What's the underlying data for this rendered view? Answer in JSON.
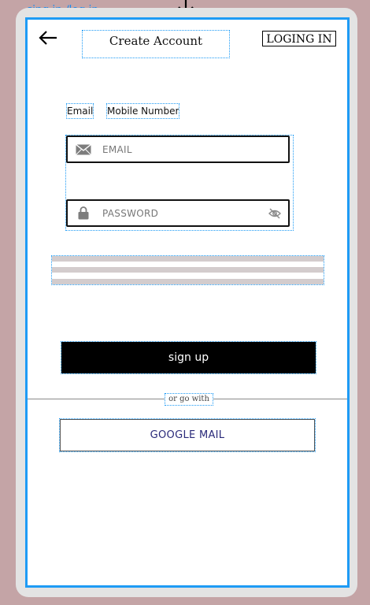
{
  "frame": {
    "label": "sing in /log in"
  },
  "header": {
    "title": "Create Account",
    "login_link": "LOGING IN",
    "back_icon": "arrow-left-icon"
  },
  "tabs": [
    {
      "label": "Email"
    },
    {
      "label": "Mobile Number"
    }
  ],
  "form": {
    "email": {
      "placeholder": "EMAIL",
      "icon": "mail-icon",
      "value": ""
    },
    "password": {
      "placeholder": "PASSWORD",
      "icon": "lock-icon",
      "toggle_icon": "eye-off-icon",
      "value": ""
    }
  },
  "actions": {
    "signup_label": "sign up",
    "divider_text": "or go with",
    "google_label": "GOOGLE MAIL"
  },
  "colors": {
    "background": "#c4a4a6",
    "selection_blue": "#1e9bf5",
    "signup_bg": "#000000",
    "google_text": "#2a2a7a"
  }
}
